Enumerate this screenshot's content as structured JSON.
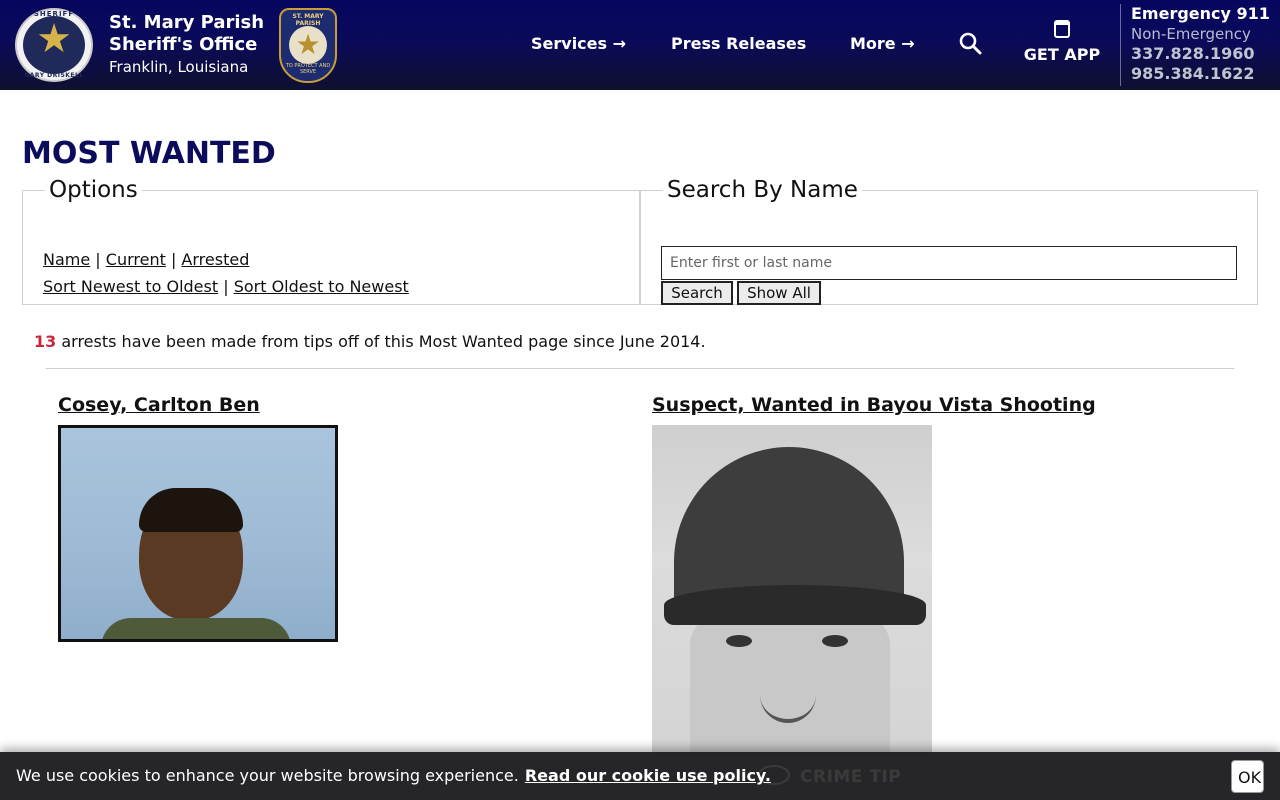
{
  "header": {
    "badge": {
      "top_text": "SHERIFF",
      "bottom_text": "GARY DRISKELL"
    },
    "org_name_line1": "St. Mary Parish",
    "org_name_line2": "Sheriff's Office",
    "org_city": "Franklin, Louisiana",
    "patch": {
      "top_text": "ST. MARY PARISH",
      "bottom_text": "TO PROTECT AND SERVE"
    },
    "nav": {
      "services": "Services →",
      "press_releases": "Press Releases",
      "more": "More →"
    },
    "get_app": "GET APP",
    "contact": {
      "emergency": "Emergency 911",
      "non_emergency_label": "Non-Emergency",
      "phone1": "337.828.1960",
      "phone2": "985.384.1622"
    }
  },
  "main": {
    "title": "MOST WANTED",
    "options": {
      "legend": "Options",
      "filter_links": [
        "Name",
        "Current",
        "Arrested"
      ],
      "sort_links": [
        "Sort Newest to Oldest",
        "Sort Oldest to Newest"
      ],
      "separator": " | "
    },
    "search": {
      "legend": "Search By Name",
      "placeholder": "Enter first or last name",
      "search_button": "Search",
      "show_all_button": "Show All"
    },
    "stats": {
      "count": "13",
      "text": " arrests have been made from tips off of this Most Wanted page since June 2014."
    },
    "entries": [
      {
        "name": "Cosey, Carlton Ben"
      },
      {
        "name": "Suspect, Wanted in Bayou Vista Shooting"
      }
    ]
  },
  "cookie_bar": {
    "message": "We use cookies to enhance your website browsing experience.",
    "policy_link": "Read our cookie use policy.",
    "ok_button": "OK",
    "background_label": "CRIME TIP"
  },
  "colors": {
    "header_bg": "#06065e",
    "title": "#0c0c5c",
    "stat_count": "#c8283c"
  }
}
